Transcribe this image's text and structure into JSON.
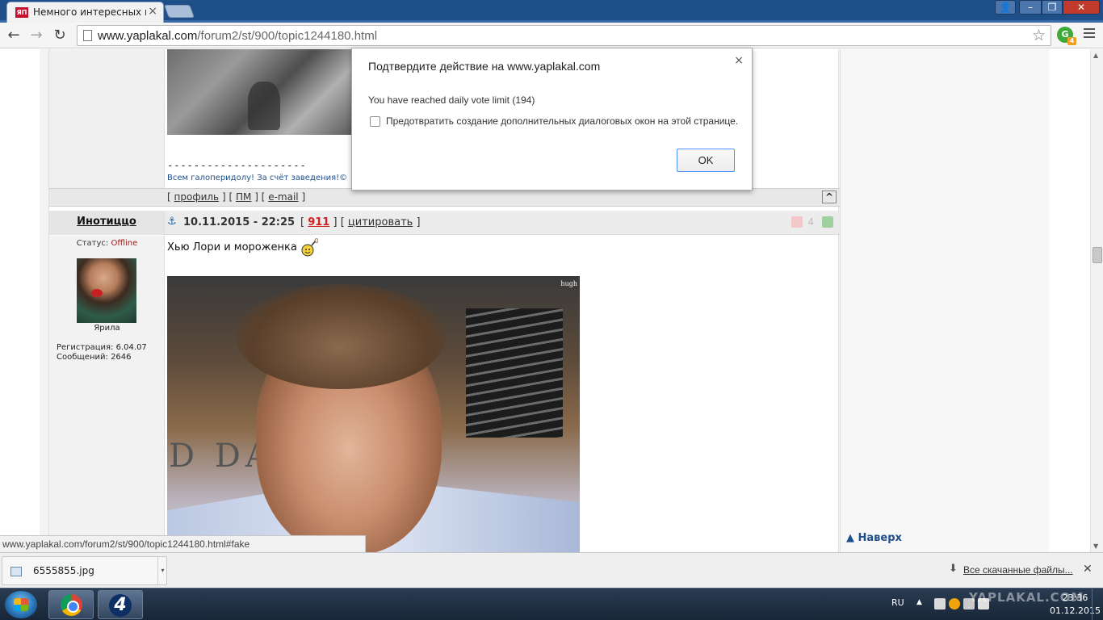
{
  "browser": {
    "tab_title": "Немного интересных ист",
    "favicon_text": "ЯП",
    "url_host": "www.yaplakal.com",
    "url_path": "/forum2/st/900/topic1244180.html",
    "ext_badge": "4",
    "ext_letter": "G"
  },
  "previous_post": {
    "signature_dashes": "---------------------",
    "signature_text": "Всем галоперидолу! За счёт заведения!©",
    "footer": {
      "open1": "[",
      "profile": "профиль",
      "sep1": "] [",
      "pm": "ПМ",
      "sep2": "] [",
      "email": "e-mail",
      "close": "]",
      "to_top": "^"
    }
  },
  "post": {
    "author": "Инотиццо",
    "anchor_icon": "anchor-icon",
    "datetime": "10.11.2015 - 22:25",
    "rating_open": "[",
    "rating": "911",
    "rating_sep": "] [",
    "quote": "цитировать",
    "quote_close": "]",
    "vote_count": "4",
    "status_label": "Статус:",
    "status_value": "Offline",
    "avatar_name": "Ярила",
    "reg_label": "Регистрация:",
    "reg_value": "6.04.07",
    "posts_label": "Сообщений:",
    "posts_value": "2646",
    "text": "Хью Лори и мороженка",
    "image_caption": "hugh",
    "image_sign": "D DA"
  },
  "sidebar": {
    "to_top": "▲ Наверх"
  },
  "status_bar": {
    "hover_url": "www.yaplakal.com/forum2/st/900/topic1244180.html#fake"
  },
  "dialog": {
    "title": "Подтвердите действие на www.yaplakal.com",
    "message": "You have reached daily vote limit (194)",
    "checkbox_label": "Предотвратить создание дополнительных диалоговых окон на этой странице.",
    "checkbox_checked": false,
    "ok_label": "OK"
  },
  "downloads": {
    "file_name": "6555855.jpg",
    "all_downloads": "Все скачанные файлы..."
  },
  "taskbar": {
    "lang": "RU",
    "time": "23:36",
    "date": "01.12.2015",
    "channel_logo": "4",
    "watermark": "YAPLAKAL.COM"
  },
  "colors": {
    "titlebar": "#1f4f88",
    "link_blue": "#1d4f8a",
    "rating_red": "#d02020",
    "offline_red": "#a01818",
    "dialog_focus": "#4d90fe"
  }
}
